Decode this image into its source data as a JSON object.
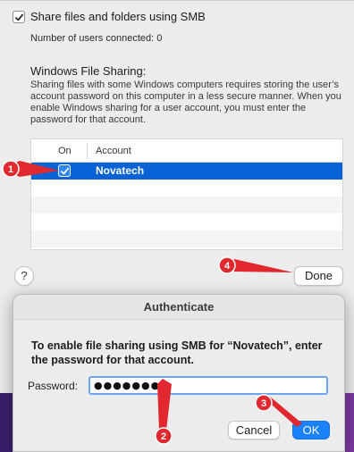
{
  "smb": {
    "checkbox_checked": true,
    "label": "Share files and folders using SMB",
    "users_connected": "Number of users connected: 0"
  },
  "windows_sharing": {
    "heading": "Windows File Sharing:",
    "description": "Sharing files with some Windows computers requires storing the user’s account password on this computer in a less secure manner. When you enable Windows sharing for a user account, you must enter the password for that account.",
    "columns": {
      "on": "On",
      "account": "Account"
    },
    "rows": [
      {
        "on": true,
        "account": "Novatech",
        "selected": true
      }
    ]
  },
  "buttons": {
    "help": "?",
    "done": "Done"
  },
  "auth_dialog": {
    "title": "Authenticate",
    "message": "To enable file sharing using SMB for “Novatech”, enter the password for that account.",
    "password_label": "Password:",
    "password_value": "●●●●●●●●",
    "cancel": "Cancel",
    "ok": "OK"
  },
  "annotations": {
    "badges": [
      "1",
      "2",
      "3",
      "4"
    ],
    "color": "#e0282e"
  },
  "colors": {
    "selection": "#0a63d6",
    "accent": "#1a82fb",
    "wallpaper": "#5b2a86"
  }
}
